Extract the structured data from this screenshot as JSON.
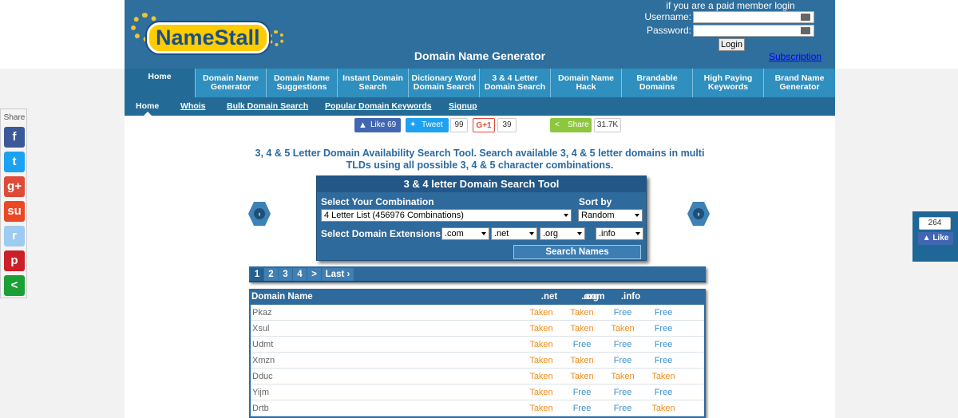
{
  "header": {
    "logo_text": "NameStall",
    "site_title": "Domain Name Generator",
    "paid_text": "if you are a paid member login",
    "username_label": "Username:",
    "password_label": "Password:",
    "login_label": "Login",
    "subscription_label": "Subscription"
  },
  "main_nav": [
    {
      "label": "Home",
      "active": true
    },
    {
      "label": "Domain Name Generator"
    },
    {
      "label": "Domain Name Suggestions"
    },
    {
      "label": "Instant Domain Search"
    },
    {
      "label": "Dictionary Word Domain Search"
    },
    {
      "label": "3 & 4 Letter Domain Search"
    },
    {
      "label": "Domain Name Hack"
    },
    {
      "label": "Brandable Domains"
    },
    {
      "label": "High Paying Keywords"
    },
    {
      "label": "Brand Name Generator"
    }
  ],
  "sub_nav": [
    "Home",
    "Whois",
    "Bulk Domain Search",
    "Popular Domain Keywords",
    "Signup"
  ],
  "social": {
    "like_label": "Like 69",
    "tweet_label": "Tweet",
    "tweet_count": "99",
    "gplus_label": "G+1",
    "gplus_count": "39",
    "share_label": "Share",
    "share_count": "31.7K"
  },
  "description": "3, 4 & 5 Letter Domain Availability Search Tool. Search available 3, 4 & 5 letter domains in multi TLDs using all possible 3, 4 & 5 character combinations.",
  "tool": {
    "title": "3 & 4 letter Domain Search Tool",
    "combination_label": "Select Your Combination",
    "combination_value": "4 Letter List (456976 Combinations)",
    "sort_label": "Sort by",
    "sort_value": "Random",
    "extensions_label": "Select Domain Extensions:",
    "extensions": [
      ".com",
      ".net",
      ".org",
      ".info"
    ],
    "search_button": "Search Names"
  },
  "pager": [
    "1",
    "2",
    "3",
    "4",
    ">",
    "Last ›"
  ],
  "table": {
    "headers": [
      "Domain Name",
      ".com",
      ".net",
      ".org",
      ".info"
    ],
    "rows": [
      {
        "name": "Pkaz",
        "status": [
          "Taken",
          "Taken",
          "Free",
          "Free"
        ]
      },
      {
        "name": "Xsul",
        "status": [
          "Taken",
          "Taken",
          "Taken",
          "Free"
        ]
      },
      {
        "name": "Udmt",
        "status": [
          "Taken",
          "Free",
          "Free",
          "Free"
        ]
      },
      {
        "name": "Xmzn",
        "status": [
          "Taken",
          "Taken",
          "Free",
          "Free"
        ]
      },
      {
        "name": "Dduc",
        "status": [
          "Taken",
          "Taken",
          "Taken",
          "Taken"
        ]
      },
      {
        "name": "Yijm",
        "status": [
          "Taken",
          "Free",
          "Free",
          "Free"
        ]
      },
      {
        "name": "Drtb",
        "status": [
          "Taken",
          "Free",
          "Free",
          "Taken"
        ]
      }
    ]
  },
  "share_sidebar": {
    "label": "Share",
    "buttons": [
      {
        "icon": "facebook-icon",
        "glyph": "f",
        "color": "#3b5998"
      },
      {
        "icon": "twitter-icon",
        "glyph": "t",
        "color": "#1da1f2"
      },
      {
        "icon": "google-plus-icon",
        "glyph": "g+",
        "color": "#dd4b39"
      },
      {
        "icon": "stumbleupon-icon",
        "glyph": "su",
        "color": "#eb4924"
      },
      {
        "icon": "reddit-icon",
        "glyph": "r",
        "color": "#9ecbf0"
      },
      {
        "icon": "pinterest-icon",
        "glyph": "p",
        "color": "#cb2027"
      },
      {
        "icon": "share-icon",
        "glyph": "<",
        "color": "#1aa035"
      }
    ]
  },
  "fb_widget": {
    "count": "264",
    "like_label": "Like"
  },
  "colors": {
    "taken": "#f08c1c",
    "free": "#3a8fce",
    "header_bg": "#2e6f9d",
    "nav_bg": "#2f8fbe"
  }
}
